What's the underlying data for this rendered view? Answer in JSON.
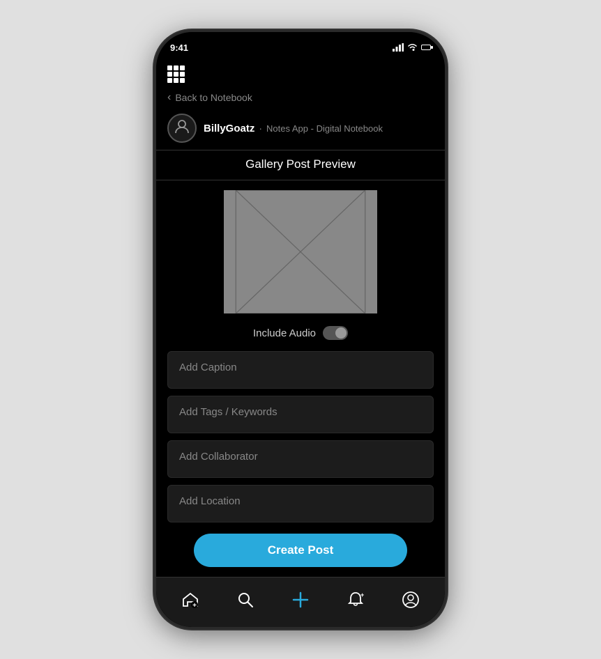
{
  "phone": {
    "status": {
      "time": "9:41"
    }
  },
  "top_bar": {
    "grid_icon": "grid"
  },
  "navigation": {
    "back_label": "Back to Notebook"
  },
  "user": {
    "username": "BillyGoatz",
    "separator": "·",
    "app_name": "Notes App - Digital Notebook"
  },
  "page": {
    "title": "Gallery Post Preview"
  },
  "audio": {
    "label": "Include Audio"
  },
  "form": {
    "caption_placeholder": "Add Caption",
    "tags_placeholder": "Add Tags / Keywords",
    "collaborator_placeholder": "Add Collaborator",
    "location_placeholder": "Add Location"
  },
  "buttons": {
    "create_post": "Create Post"
  },
  "bottom_nav": {
    "items": [
      {
        "id": "home-add",
        "icon": "⊕",
        "label": ""
      },
      {
        "id": "search",
        "icon": "🔍",
        "label": ""
      },
      {
        "id": "plus",
        "icon": "+",
        "label": ""
      },
      {
        "id": "notifications",
        "icon": "🔔",
        "label": ""
      },
      {
        "id": "profile",
        "icon": "👤",
        "label": ""
      }
    ]
  }
}
